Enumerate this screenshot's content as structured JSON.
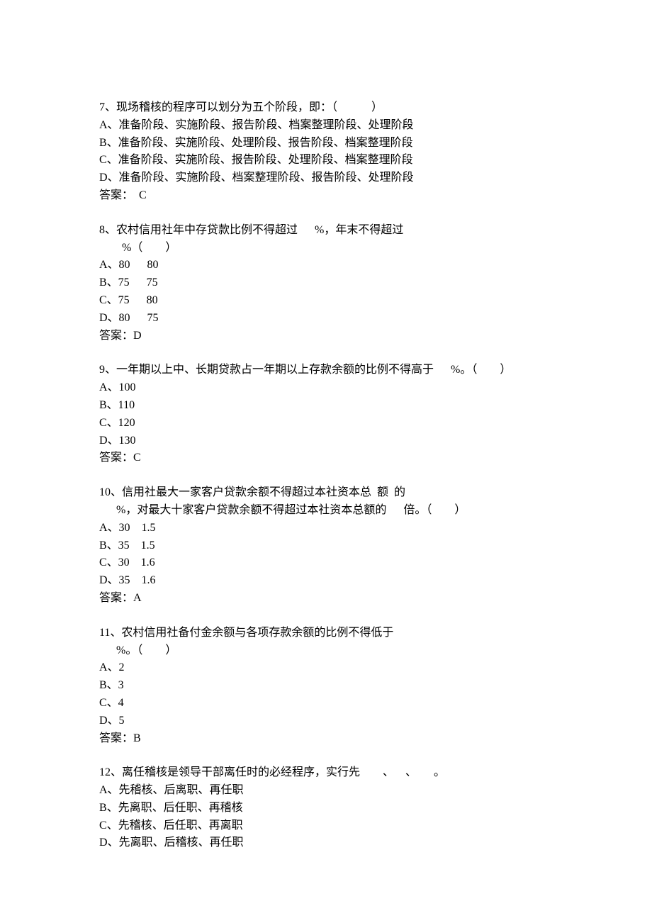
{
  "questions": [
    {
      "prompt": "7、现场稽核的程序可以划分为五个阶段，即：（            ）",
      "options": [
        "A、准备阶段、实施阶段、报告阶段、档案整理阶段、处理阶段",
        "B、准备阶段、实施阶段、处理阶段、报告阶段、档案整理阶段",
        "C、准备阶段、实施阶段、报告阶段、处理阶段、档案整理阶段",
        "D、准备阶段、实施阶段、档案整理阶段、报告阶段、处理阶段"
      ],
      "answer": "答案：  C"
    },
    {
      "prompt": "8、农村信用社年中存贷款比例不得超过      %，年末不得超过\n        %（        ）",
      "options": [
        "A、80      80",
        "B、75      75",
        "C、75      80",
        "D、80      75"
      ],
      "answer": "答案：D"
    },
    {
      "prompt": "9、一年期以上中、长期贷款占一年期以上存款余额的比例不得高于      %。（        ）",
      "options": [
        "A、100",
        "B、110",
        "C、120",
        "D、130"
      ],
      "answer": "答案：C"
    },
    {
      "prompt": "10、信用社最大一家客户贷款余额不得超过本社资本总  额  的\n      %，对最大十家客户贷款余额不得超过本社资本总额的      倍。（        ）",
      "options": [
        "A、30    1.5",
        "B、35    1.5",
        "C、30    1.6",
        "D、35    1.6"
      ],
      "answer": "答案：A"
    },
    {
      "prompt": "11、农村信用社备付金余额与各项存款余额的比例不得低于\n      %。（        ）",
      "options": [
        "A、2",
        "B、3",
        "C、4",
        "D、5"
      ],
      "answer": "答案：B"
    },
    {
      "prompt": "12、离任稽核是领导干部离任时的必经程序，实行先        、    、      。",
      "options": [
        "A、先稽核、后离职、再任职",
        "B、先离职、后任职、再稽核",
        "C、先稽核、后任职、再离职",
        "D、先离职、后稽核、再任职"
      ],
      "answer": ""
    }
  ]
}
